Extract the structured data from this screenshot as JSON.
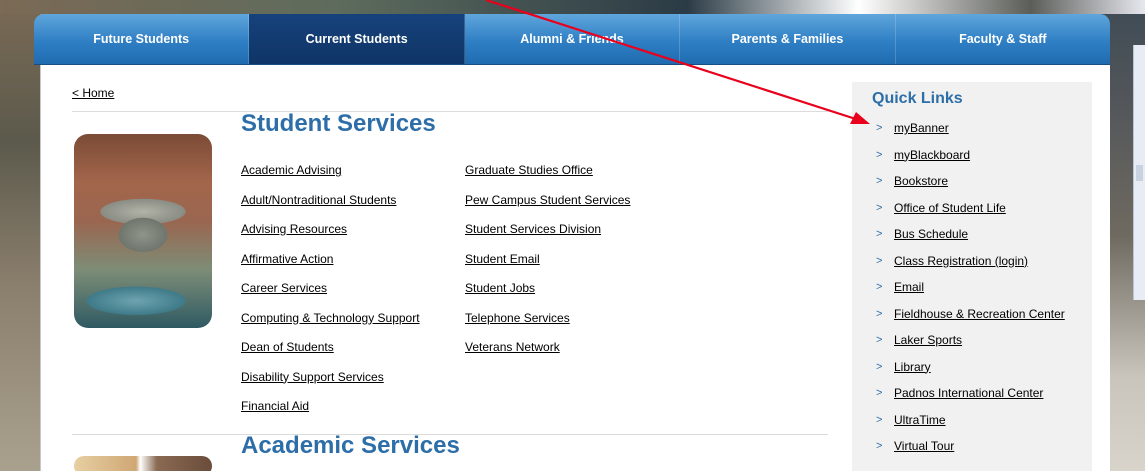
{
  "nav": {
    "tabs": [
      {
        "label": "Future Students"
      },
      {
        "label": "Current Students"
      },
      {
        "label": "Alumni & Friends"
      },
      {
        "label": "Parents & Families"
      },
      {
        "label": "Faculty & Staff"
      }
    ],
    "active_tab": "Current Students"
  },
  "breadcrumb": {
    "home_label": "< Home"
  },
  "student_services": {
    "title": "Student Services",
    "column1": [
      "Academic Advising",
      "Adult/Nontraditional Students",
      "Advising Resources",
      "Affirmative Action",
      "Career Services",
      "Computing & Technology Support",
      "Dean of Students",
      "Disability Support Services",
      "Financial Aid"
    ],
    "column2": [
      "Graduate Studies Office",
      "Pew Campus Student Services",
      "Student Services Division",
      "Student Email",
      "Student Jobs",
      "Telephone Services",
      "Veterans Network"
    ]
  },
  "academic_services": {
    "title": "Academic Services"
  },
  "quick_links": {
    "title": "Quick Links",
    "items": [
      "myBanner",
      "myBlackboard",
      "Bookstore",
      "Office of Student Life",
      "Bus Schedule",
      "Class Registration (login)",
      "Email",
      "Fieldhouse & Recreation Center",
      "Laker Sports",
      "Library",
      "Padnos International Center",
      "UltraTime",
      "Virtual Tour"
    ],
    "bullet": ">"
  },
  "colors": {
    "nav_blue": "#2f7fc4",
    "nav_active": "#0f3566",
    "heading_blue": "#2d6ea8",
    "annotation_arrow": "#e8001c"
  }
}
